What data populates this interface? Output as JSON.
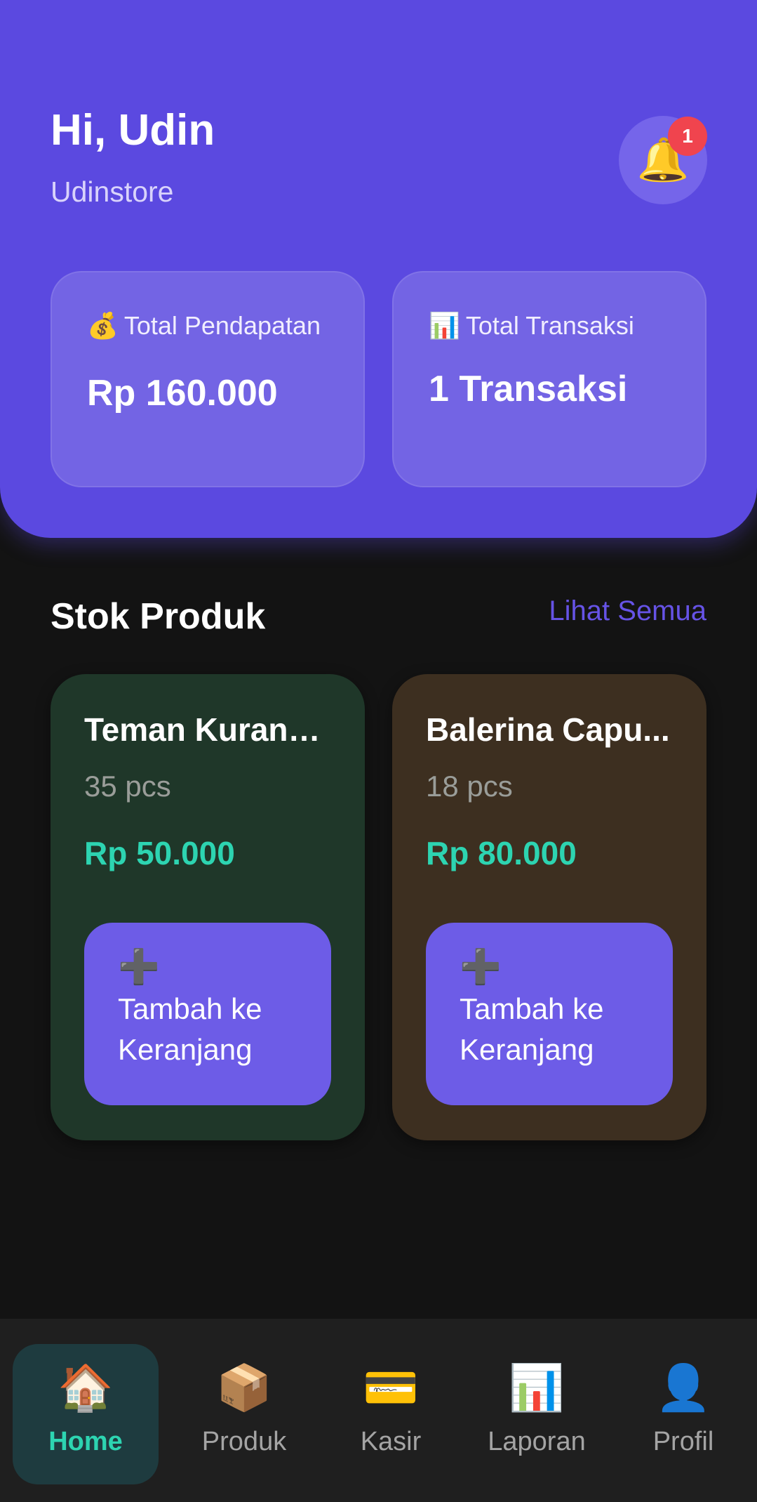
{
  "header": {
    "greeting": "Hi, Udin",
    "store_name": "Udinstore",
    "notification_count": "1",
    "bell_icon": "🔔"
  },
  "stats": [
    {
      "icon": "💰",
      "label": "Total Pendapatan",
      "value": "Rp 160.000"
    },
    {
      "icon": "📊",
      "label": "Total Transaksi",
      "value": "1 Transaksi"
    }
  ],
  "section": {
    "title": "Stok Produk",
    "see_all": "Lihat Semua"
  },
  "products": [
    {
      "name": "Teman Kurang...",
      "qty": "35 pcs",
      "price": "Rp 50.000",
      "add_icon": "➕",
      "add_label": "Tambah ke Keranjang"
    },
    {
      "name": "Balerina Capu...",
      "qty": "18 pcs",
      "price": "Rp 80.000",
      "add_icon": "➕",
      "add_label": "Tambah ke Keranjang"
    }
  ],
  "nav": [
    {
      "icon": "🏠",
      "label": "Home",
      "active": true
    },
    {
      "icon": "📦",
      "label": "Produk"
    },
    {
      "icon": "💳",
      "label": "Kasir"
    },
    {
      "icon": "📊",
      "label": "Laporan"
    },
    {
      "icon": "👤",
      "label": "Profil"
    }
  ],
  "colors": {
    "primary": "#5b49e0",
    "accent_teal": "#2dd4b1",
    "badge_red": "#f0444e",
    "background": "#131313"
  }
}
